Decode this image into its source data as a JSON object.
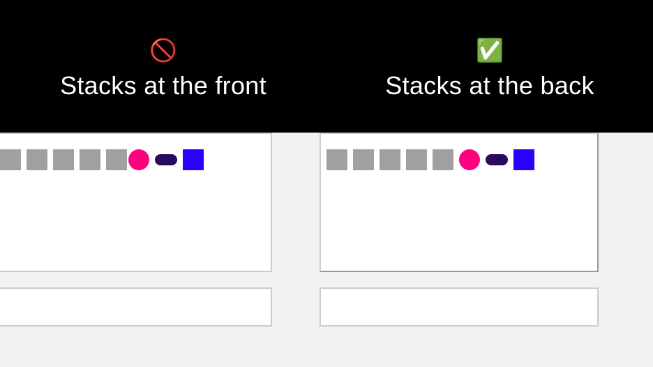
{
  "left": {
    "icon": "🚫",
    "title": "Stacks at the front"
  },
  "right": {
    "icon": "✅",
    "title": "Stacks at the back"
  }
}
